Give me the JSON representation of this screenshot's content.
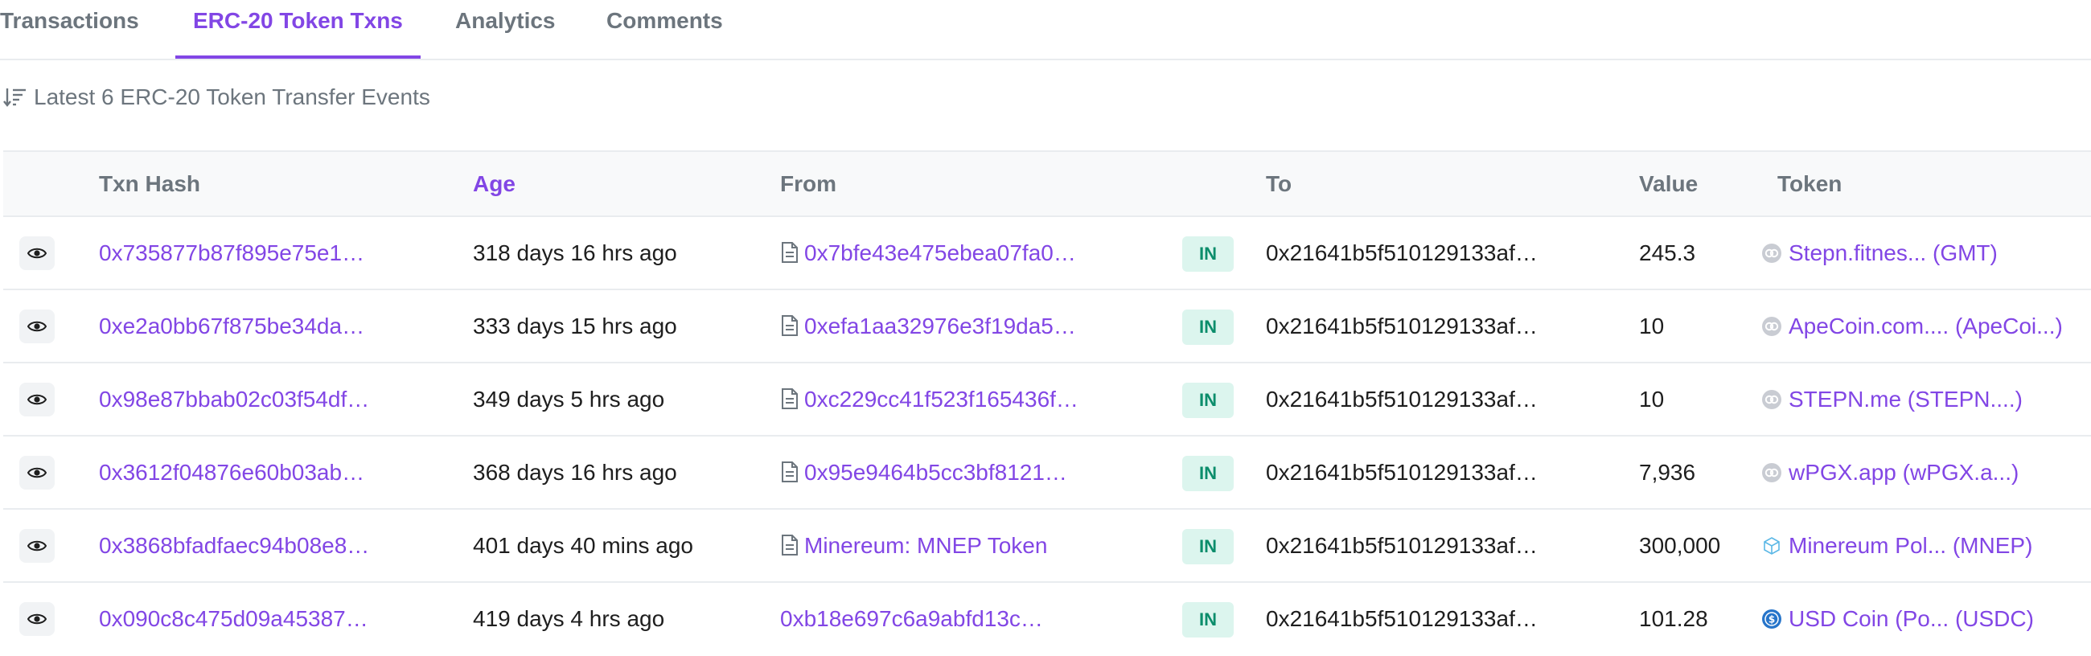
{
  "tabs": [
    {
      "label": "Transactions",
      "active": false
    },
    {
      "label": "ERC-20 Token Txns",
      "active": true
    },
    {
      "label": "Analytics",
      "active": false
    },
    {
      "label": "Comments",
      "active": false
    }
  ],
  "summary": "Latest 6 ERC-20 Token Transfer Events",
  "columns": {
    "txn_hash": "Txn Hash",
    "age": "Age",
    "from": "From",
    "to": "To",
    "value": "Value",
    "token": "Token"
  },
  "rows": [
    {
      "hash": "0x735877b87f895e75e1…",
      "age": "318 days 16 hrs ago",
      "from": "0x7bfe43e475ebea07fa0…",
      "from_is_contract": true,
      "direction": "IN",
      "to": "0x21641b5f510129133af…",
      "value": "245.3",
      "token": "Stepn.fitnes... (GMT)",
      "token_icon": "generic-token-icon"
    },
    {
      "hash": "0xe2a0bb67f875be34da…",
      "age": "333 days 15 hrs ago",
      "from": "0xefa1aa32976e3f19da5…",
      "from_is_contract": true,
      "direction": "IN",
      "to": "0x21641b5f510129133af…",
      "value": "10",
      "token": "ApeCoin.com.... (ApeCoi...)",
      "token_icon": "generic-token-icon"
    },
    {
      "hash": "0x98e87bbab02c03f54df…",
      "age": "349 days 5 hrs ago",
      "from": "0xc229cc41f523f165436f…",
      "from_is_contract": true,
      "direction": "IN",
      "to": "0x21641b5f510129133af…",
      "value": "10",
      "token": "STEPN.me (STEPN....)",
      "token_icon": "generic-token-icon"
    },
    {
      "hash": "0x3612f04876e60b03ab…",
      "age": "368 days 16 hrs ago",
      "from": "0x95e9464b5cc3bf8121…",
      "from_is_contract": true,
      "direction": "IN",
      "to": "0x21641b5f510129133af…",
      "value": "7,936",
      "token": "wPGX.app (wPGX.a...)",
      "token_icon": "generic-token-icon"
    },
    {
      "hash": "0x3868bfadfaec94b08e8…",
      "age": "401 days 40 mins ago",
      "from": "Minereum: MNEP Token",
      "from_is_contract": true,
      "direction": "IN",
      "to": "0x21641b5f510129133af…",
      "value": "300,000",
      "token": "Minereum Pol... (MNEP)",
      "token_icon": "cube-icon"
    },
    {
      "hash": "0x090c8c475d09a45387…",
      "age": "419 days 4 hrs ago",
      "from": "0xb18e697c6a9abfd13c…",
      "from_is_contract": false,
      "direction": "IN",
      "to": "0x21641b5f510129133af…",
      "value": "101.28",
      "token": "USD Coin (Po... (USDC)",
      "token_icon": "usdc-icon"
    }
  ],
  "colors": {
    "accent": "#8246e5",
    "badge_bg": "#dcf5ee",
    "badge_text": "#0b8d6b",
    "muted": "#6c757d"
  }
}
